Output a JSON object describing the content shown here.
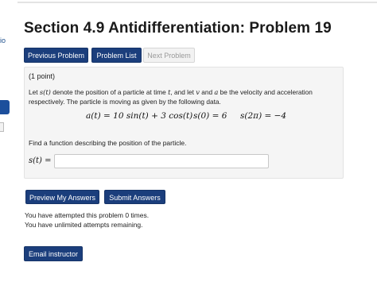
{
  "sidebar_fragment": {
    "text": "io"
  },
  "header": {
    "title": "Section 4.9 Antidifferentiation: Problem 19"
  },
  "nav": {
    "previous": "Previous Problem",
    "list": "Problem List",
    "next": "Next Problem"
  },
  "problem": {
    "points": "(1 point)",
    "statement_parts": [
      "Let ",
      "s(t)",
      " denote the position of a particle at time ",
      "t",
      ", and let ",
      "v",
      " and ",
      "a",
      " be the velocity and acceleration respectively. The particle is moving as given by the following data."
    ],
    "equations": [
      "a(t) = 10 sin(t) + 3 cos(t)",
      "s(0) = 6",
      "s(2π) = −4"
    ],
    "question": "Find a function describing the position of the particle.",
    "answer_label": "s(t) =",
    "answer_value": ""
  },
  "actions": {
    "preview": "Preview My Answers",
    "submit": "Submit Answers"
  },
  "status": {
    "attempts": "You have attempted this problem 0 times.",
    "remaining": "You have unlimited attempts remaining."
  },
  "footer": {
    "email": "Email instructor"
  },
  "colors": {
    "primary_button": "#1b3e7c",
    "problem_background": "#f5f5f5",
    "disabled_button": "#f2f2f2"
  }
}
